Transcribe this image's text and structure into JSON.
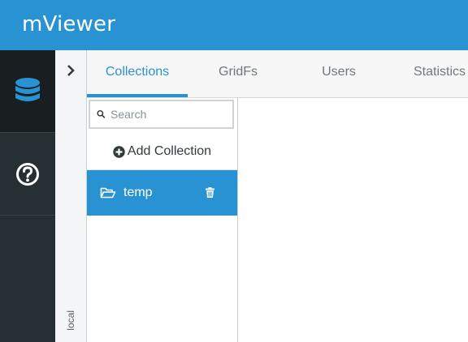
{
  "header": {
    "app_title": "mViewer",
    "accent": "#2992d2"
  },
  "side_rail": {
    "items": [
      {
        "icon": "database-icon"
      },
      {
        "icon": "help-icon"
      }
    ]
  },
  "connection": {
    "label": "local",
    "expand_icon": "chevron-right-icon"
  },
  "tabs": [
    {
      "label": "Collections",
      "active": true
    },
    {
      "label": "GridFs",
      "active": false
    },
    {
      "label": "Users",
      "active": false
    },
    {
      "label": "Statistics",
      "active": false
    }
  ],
  "collections_panel": {
    "search": {
      "placeholder": "Search",
      "value": ""
    },
    "add_label": "Add Collection",
    "items": [
      {
        "name": "temp",
        "selected": true
      }
    ]
  }
}
